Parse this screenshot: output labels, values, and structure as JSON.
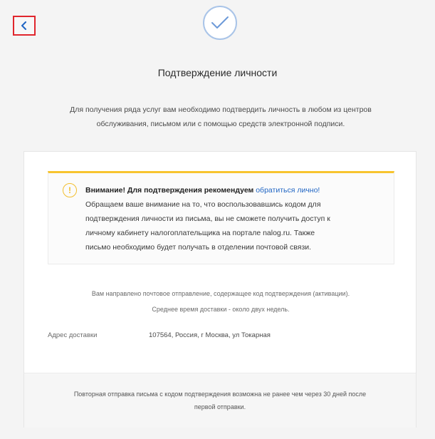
{
  "header": {
    "back_icon": "chevron-left-icon",
    "status_icon": "checkmark-icon",
    "title": "Подтверждение личности"
  },
  "intro": {
    "line1": "Для получения ряда услуг вам необходимо подтвердить личность в любом из центров",
    "line2": "обслуживания, письмом или с помощью средств электронной подписи."
  },
  "warning": {
    "icon": "exclamation-icon",
    "bold_text": "Внимание! Для подтверждения рекомендуем",
    "link_text": "обратиться лично!",
    "line1": "Обращаем ваше внимание на то, что воспользовавшись кодом для",
    "line2": "подтверждения личности из письма, вы не сможете получить доступ к",
    "line3": "личному кабинету налогоплательщика на портале nalog.ru. Также",
    "line4": "письмо необходимо будет получать в отделении почтовой связи."
  },
  "notice": {
    "line1": "Вам направлено почтовое отправление, содержащее код подтверждения (активации).",
    "line2": "Среднее время доставки - около двух недель."
  },
  "delivery": {
    "label": "Адрес доставки",
    "value": "107564, Россия, г Москва, ул Токарная"
  },
  "footer": {
    "line1": "Повторная отправка письма с кодом подтверждения возможна не ранее чем через 30 дней после",
    "line2": "первой отправки."
  },
  "colors": {
    "accent_link": "#2166c4",
    "warning_yellow": "#f7c42f",
    "highlight_red": "#e0262d",
    "check_blue": "#6d9ad8"
  }
}
